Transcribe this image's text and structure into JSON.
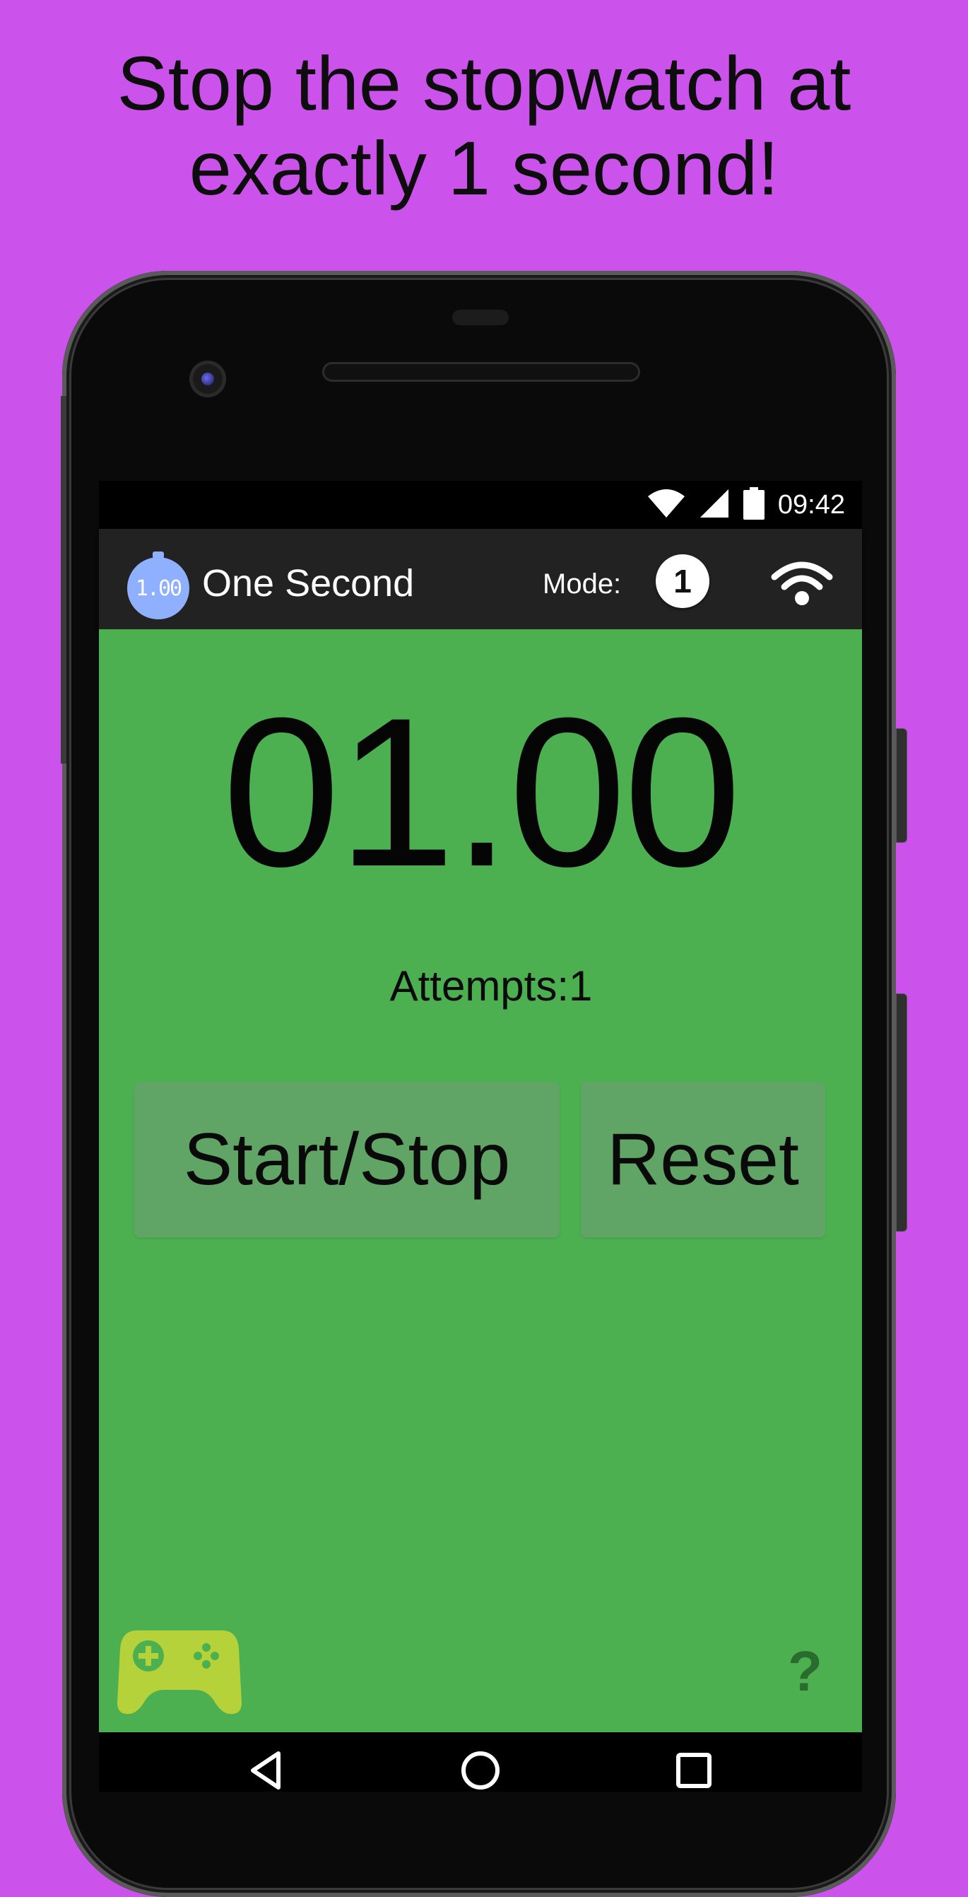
{
  "promo": {
    "headline_line1": "Stop the stopwatch at",
    "headline_line2": "exactly 1 second!"
  },
  "statusbar": {
    "icons": [
      "wifi-icon",
      "cell-signal-icon",
      "battery-icon"
    ],
    "time": "09:42"
  },
  "appbar": {
    "logo_text": "1.00",
    "title": "One Second",
    "mode_label": "Mode:",
    "mode_value": "1",
    "connectivity_icon": "wifi-icon"
  },
  "main": {
    "timer_value": "01.00",
    "attempts_label": "Attempts:1",
    "start_stop_label": "Start/Stop",
    "reset_label": "Reset",
    "games_icon": "gamepad-icon",
    "help_label": "?"
  },
  "navbar": {
    "buttons": [
      "back",
      "home",
      "recents"
    ]
  },
  "colors": {
    "background": "#cc52ec",
    "app_bar": "#222222",
    "content": "#4caf50",
    "button": "#60a466",
    "logo": "#8fb0ff",
    "games_icon": "#b5d23a"
  }
}
